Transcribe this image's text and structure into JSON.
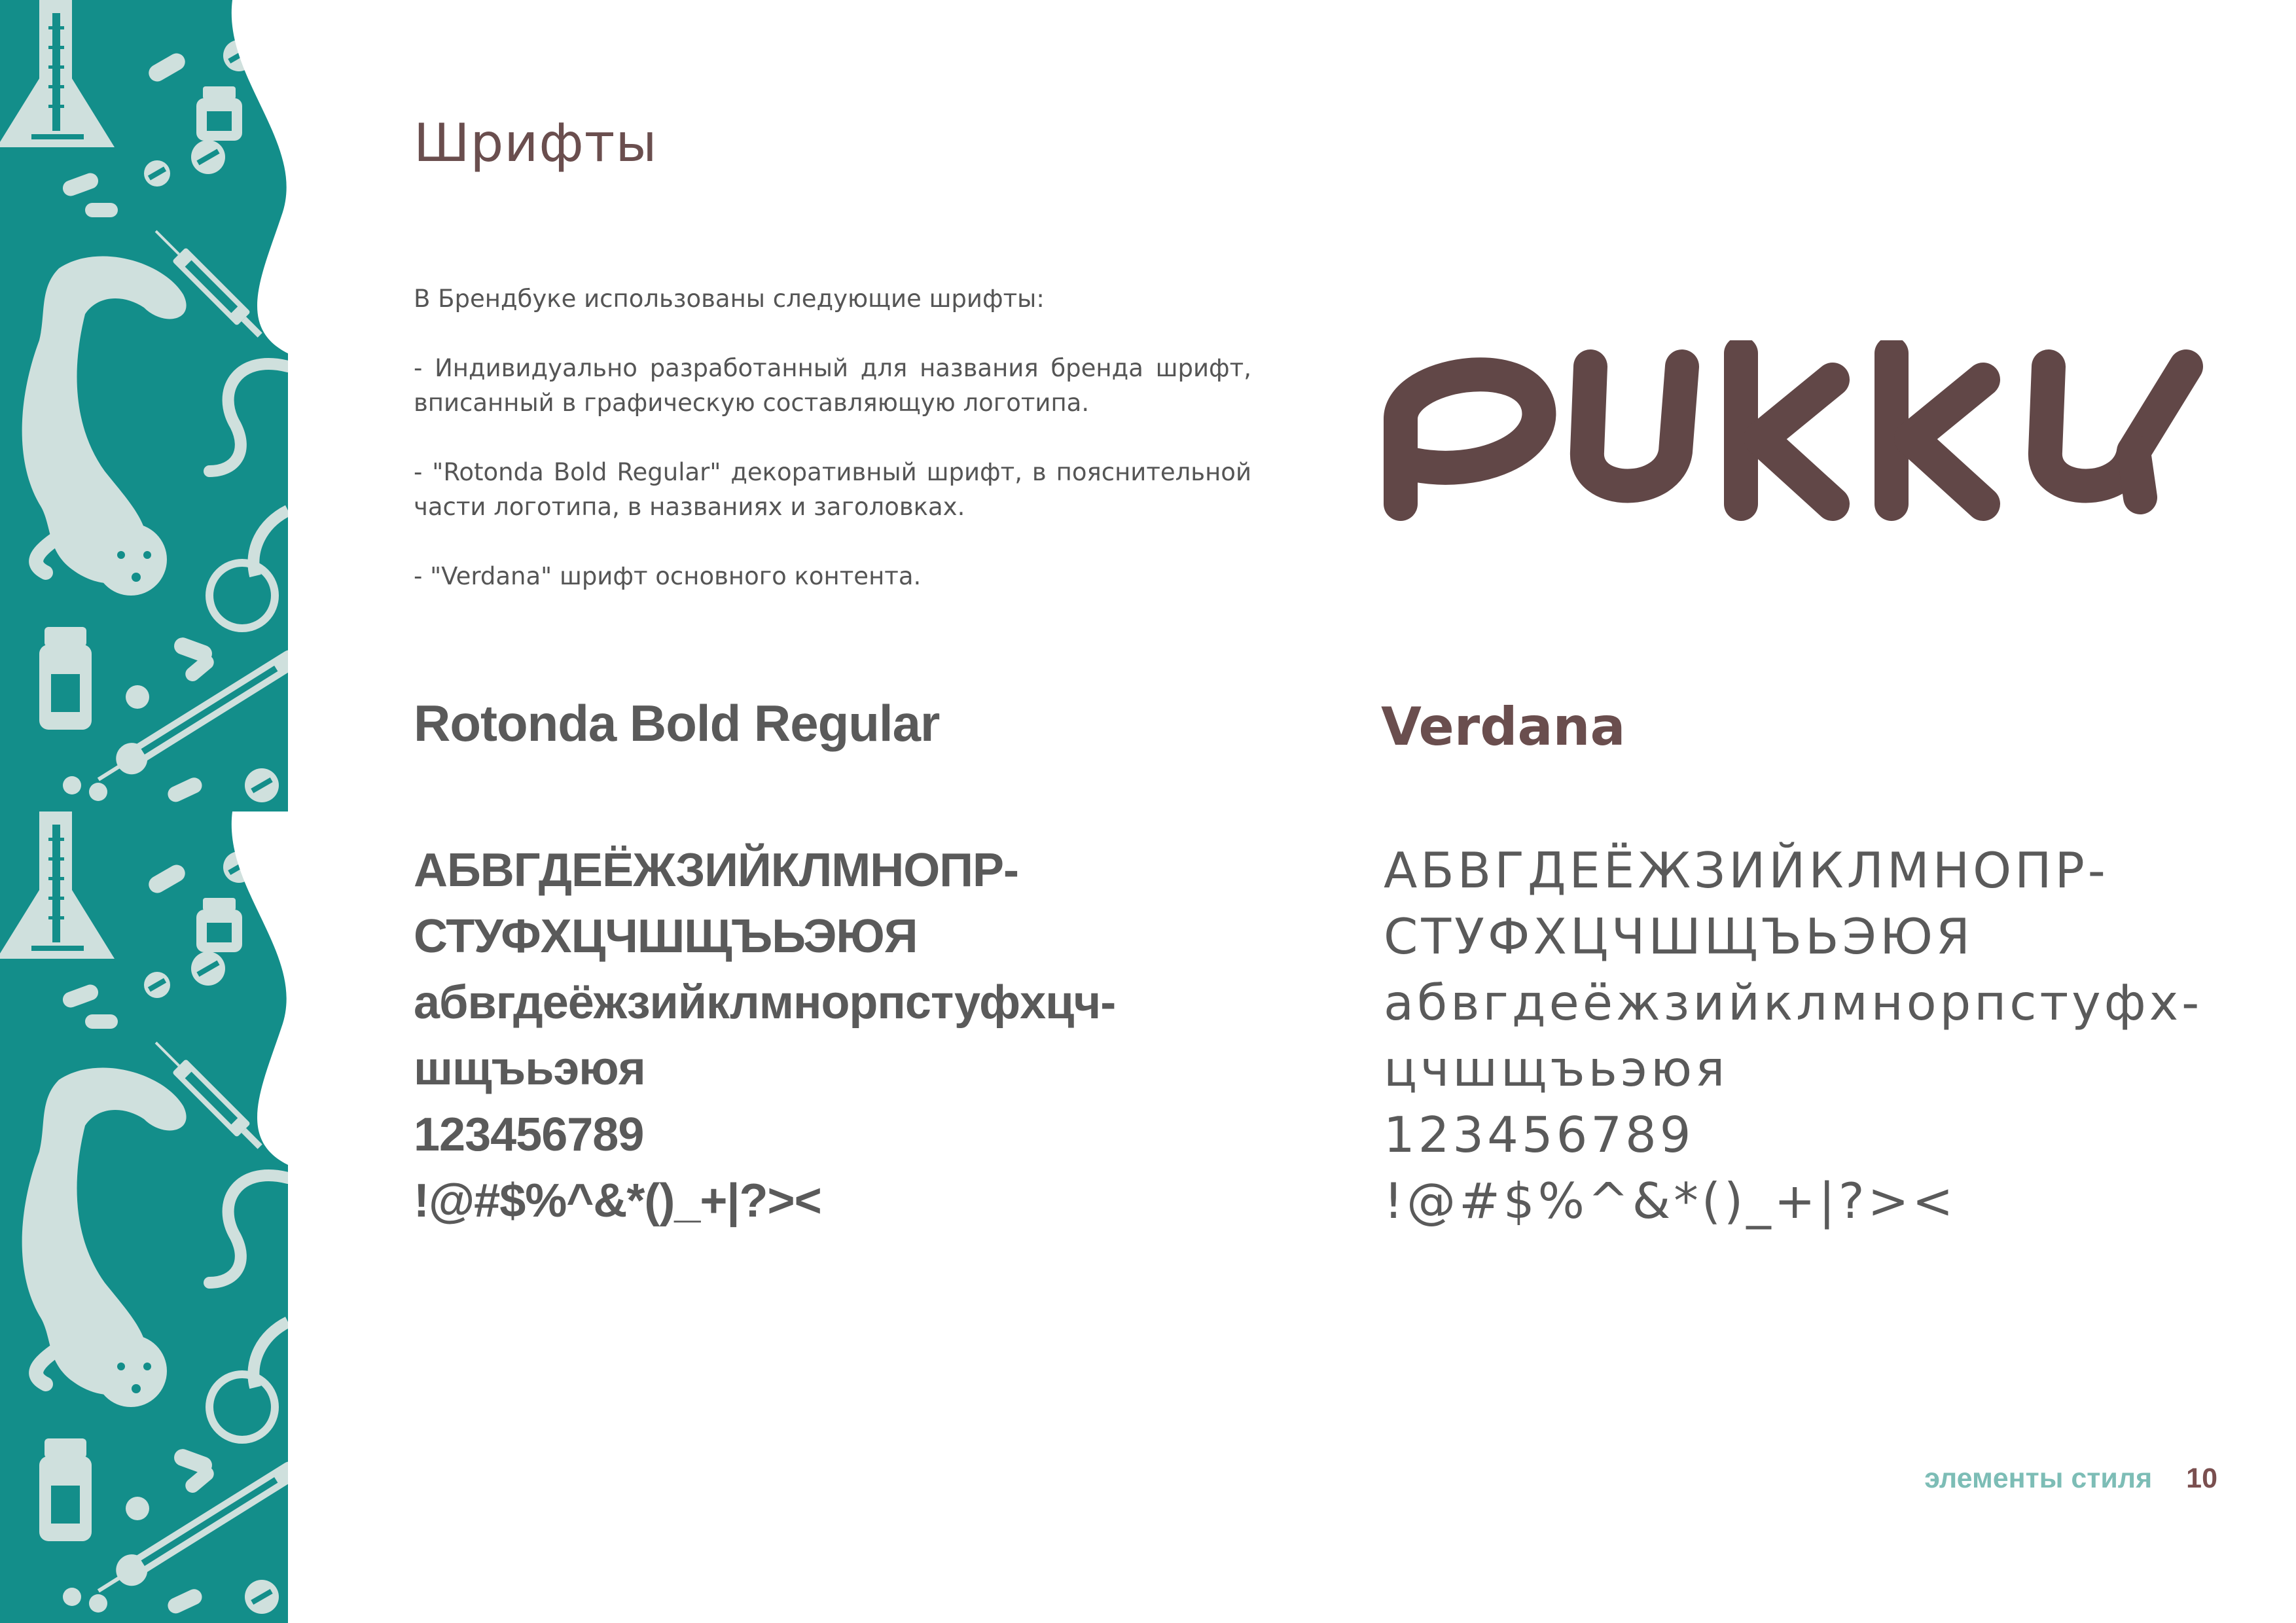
{
  "page": {
    "title": "Шрифты",
    "intro": [
      "В Брендбуке использованы следующие шрифты:",
      "- Индивидуально разработанный для названия бренда шрифт, вписанный в графическую составляющую логотипа.",
      "- \"Rotonda Bold Regular\"  декоративный шрифт, в пояснительной части логотипа, в названиях и заголовках.",
      "- \"Verdana\" шрифт основного контента."
    ],
    "logo_text": "PUKKU"
  },
  "fonts": {
    "rotonda": {
      "name": "Rotonda Bold Regular",
      "lines": [
        "АБВГДЕЁЖЗИЙКЛМНОПР-",
        "СТУФХЦЧШЩЪЬЭЮЯ",
        "абвгдеёжзийклмнорпстуфхцч-",
        "шщъьэюя",
        "123456789",
        "!@#$%^&*()_+|?><"
      ]
    },
    "verdana": {
      "name": "Verdana",
      "lines": [
        "АБВГДЕЁЖЗИЙКЛМНОПР-",
        "СТУФХЦЧШЩЪЬЭЮЯ",
        "абвгдеёжзийклмнорпстуфх-",
        "цчшщъьэюя",
        "123456789",
        "!@#$%^&*()_+|?><"
      ]
    }
  },
  "footer": {
    "section": "элементы стиля",
    "page_number": "10"
  },
  "colors": {
    "sidebar_teal": "#138e8a",
    "sidebar_pattern": "#cfe0dd",
    "title_brown": "#6a4e4e",
    "logo_brown": "#614747",
    "body_gray": "#555555",
    "footer_teal": "#7dbdb6"
  },
  "icons": [
    "flask-icon",
    "syringe-icon",
    "ferret-icon",
    "pill-icon",
    "tablet-icon",
    "jar-icon",
    "thermometer-icon",
    "stethoscope-icon"
  ]
}
